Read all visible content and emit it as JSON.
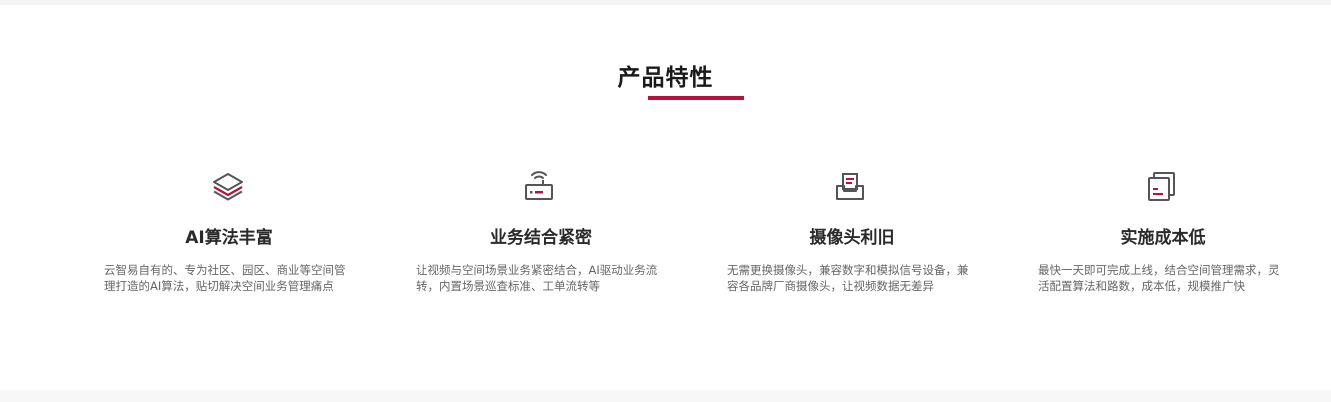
{
  "section": {
    "title": "产品特性"
  },
  "colors": {
    "accent": "#b5133c",
    "icon_gray": "#555555",
    "title_text": "#1a1a1a",
    "desc_text": "#666666"
  },
  "features": [
    {
      "icon": "layers-icon",
      "title": "AI算法丰富",
      "description": "云智易自有的、专为社区、园区、商业等空间管理打造的AI算法，贴切解决空间业务管理痛点"
    },
    {
      "icon": "router-icon",
      "title": "业务结合紧密",
      "description": "让视频与空间场景业务紧密结合，AI驱动业务流转，内置场景巡查标准、工单流转等"
    },
    {
      "icon": "inbox-document-icon",
      "title": "摄像头利旧",
      "description": "无需更换摄像头，兼容数字和模拟信号设备，兼容各品牌厂商摄像头，让视频数据无差异"
    },
    {
      "icon": "stacked-cards-icon",
      "title": "实施成本低",
      "description": "最快一天即可完成上线，结合空间管理需求，灵活配置算法和路数，成本低，规模推广快"
    }
  ]
}
